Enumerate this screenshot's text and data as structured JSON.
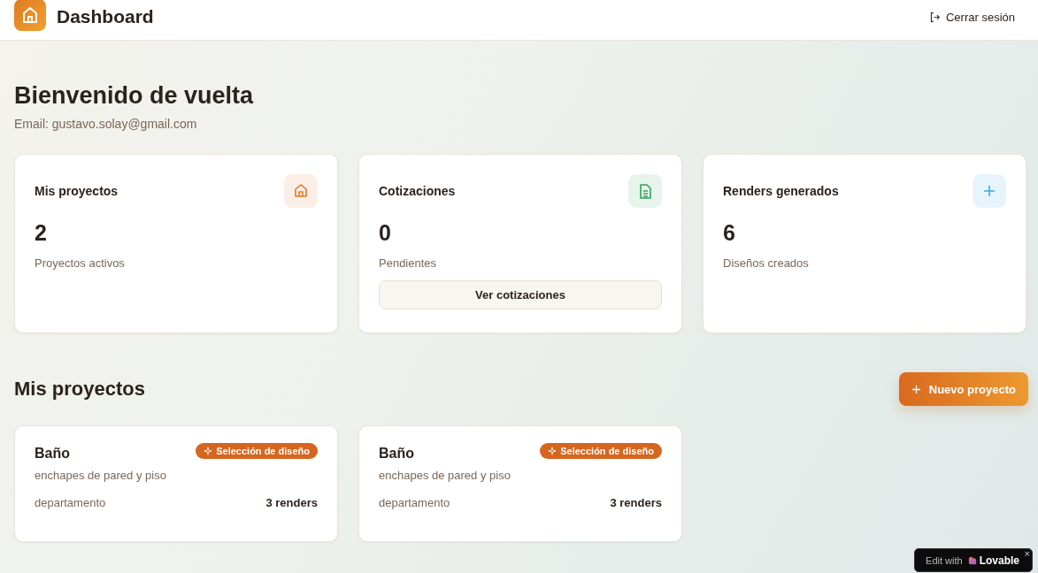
{
  "header": {
    "title": "Dashboard",
    "logout": "Cerrar sesión"
  },
  "welcome": {
    "title": "Bienvenido de vuelta",
    "email": "Email: gustavo.solay@gmail.com"
  },
  "stats": [
    {
      "title": "Mis proyectos",
      "kind": "home",
      "value": "2",
      "caption": "Proyectos activos"
    },
    {
      "title": "Cotizaciones",
      "kind": "document",
      "value": "0",
      "caption": "Pendientes",
      "button": "Ver cotizaciones"
    },
    {
      "title": "Renders generados",
      "kind": "plus",
      "value": "6",
      "caption": "Diseños creados"
    }
  ],
  "projects_section": {
    "title": "Mis proyectos",
    "new_button": "Nuevo proyecto"
  },
  "projects": [
    {
      "name": "Baño",
      "status": "Selección de diseño",
      "description": "enchapes de pared y piso",
      "type": "departamento",
      "renders": "3 renders"
    },
    {
      "name": "Baño",
      "status": "Selección de diseño",
      "description": "enchapes de pared y piso",
      "type": "departamento",
      "renders": "3 renders"
    }
  ],
  "badge": {
    "prefix": "Edit with",
    "brand": "Lovable",
    "close": "×"
  }
}
